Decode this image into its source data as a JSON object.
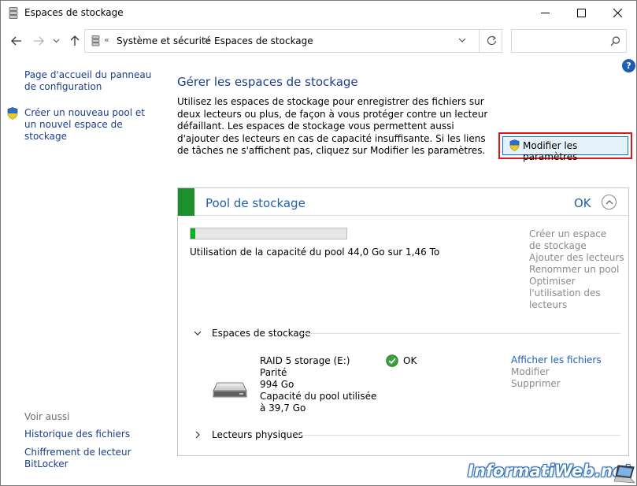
{
  "window": {
    "title": "Espaces de stockage"
  },
  "navbar": {
    "breadcrumb_prefix": "«",
    "crumbs": [
      "Système et sécurité",
      "Espaces de stockage"
    ],
    "crumb_separator": ">",
    "search_placeholder": ""
  },
  "sidebar": {
    "links": [
      "Page d'accueil du panneau de configuration",
      "Créer un nouveau pool et un nouvel espace de stockage"
    ],
    "see_also_title": "Voir aussi",
    "see_also": [
      "Historique des fichiers",
      "Chiffrement de lecteur BitLocker"
    ]
  },
  "main": {
    "help_label": "?",
    "title": "Gérer les espaces de stockage",
    "description": "Utilisez les espaces de stockage pour enregistrer des fichiers sur deux lecteurs ou plus, de façon à vous protéger contre un lecteur défaillant. Les espaces de stockage vous permettent aussi d'ajouter des lecteurs en cas de capacité insuffisante. Si les liens de tâches ne s'affichent pas, cliquez sur Modifier les paramètres.",
    "modify_button": "Modifier les paramètres"
  },
  "pool": {
    "title": "Pool de stockage",
    "status": "OK",
    "usage_fraction": 0.03,
    "usage_text": "Utilisation de la capacité du pool 44,0 Go sur 1,46 To",
    "tasks": [
      "Créer un espace de stockage",
      "Ajouter des lecteurs",
      "Renommer un pool",
      "Optimiser l'utilisation des lecteurs"
    ],
    "spaces_section": "Espaces de stockage",
    "space": {
      "name": "RAID 5 storage (E:)",
      "type": "Parité",
      "size": "994 Go",
      "used": "Capacité du pool utilisée à 39,7 Go",
      "status": "OK",
      "link_view": "Afficher les fichiers",
      "link_modify": "Modifier",
      "link_delete": "Supprimer"
    },
    "physical_section": "Lecteurs physiques"
  },
  "watermark": {
    "text": "InformatiWeb.net"
  },
  "colors": {
    "accent": "#1e5fb0",
    "pool_green": "#1e8f2d",
    "progress": "#06b025",
    "highlight": "#e0151c"
  }
}
